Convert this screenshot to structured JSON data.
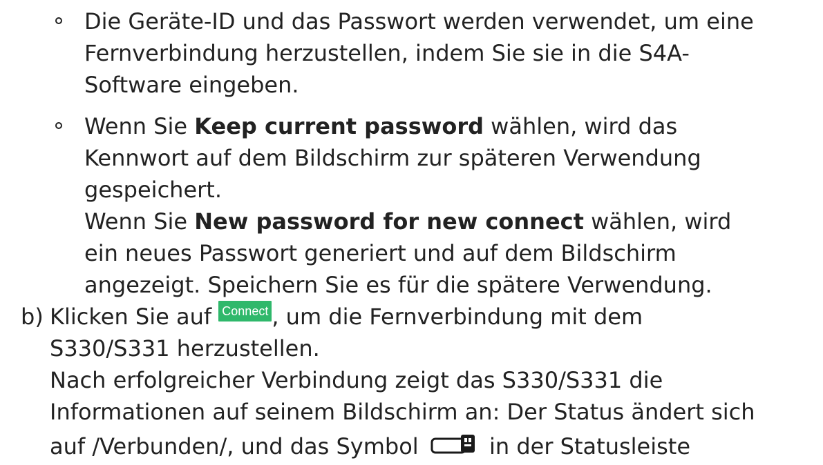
{
  "bullets": [
    {
      "lines": [
        "Die Geräte-ID und das Passwort werden verwendet, um eine",
        "Fernverbindung herzustellen, indem Sie sie in die S4A-",
        "Software eingeben."
      ]
    },
    {
      "line1_prefix": "Wenn Sie ",
      "line1_bold": "Keep current password",
      "line1_suffix": " wählen, wird das",
      "line2": "Kennwort auf dem Bildschirm zur späteren Verwendung",
      "line3": "gespeichert.",
      "line4_prefix": "Wenn Sie ",
      "line4_bold": "New password for new connect",
      "line4_suffix": " wählen, wird",
      "line5": "ein neues Passwort generiert und auf dem Bildschirm",
      "line6": "angezeigt. Speichern Sie es für die spätere Verwendung."
    }
  ],
  "step_b": {
    "marker": "b)",
    "line1_prefix": "Klicken Sie auf ",
    "connect_button_label": "Connect",
    "line1_suffix": ", um die Fernverbindung mit dem",
    "line2": "S330/S331 herzustellen.",
    "line3": "Nach erfolgreicher Verbindung zeigt das S330/S331 die",
    "line4": "Informationen auf seinem Bildschirm an: Der Status ändert sich",
    "line5_prefix": "auf /Verbunden/, und das Symbol ",
    "usb_icon_name": "usb-connection-icon",
    "line5_suffix": " in der Statusleiste"
  },
  "colors": {
    "text": "#222222",
    "connect_button_bg": "#2fb86b",
    "connect_button_text": "#ffffff"
  }
}
